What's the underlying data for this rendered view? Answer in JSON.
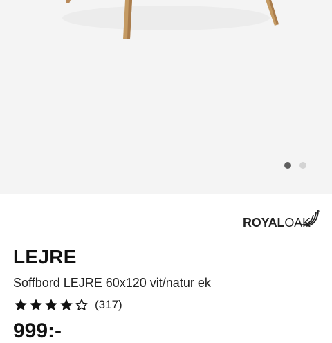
{
  "gallery": {
    "slide_count": 2,
    "active_slide": 1
  },
  "brand": {
    "logo_royal": "ROYAL",
    "logo_oak": "OAK"
  },
  "product": {
    "name": "LEJRE",
    "description": "Soffbord LEJRE 60x120 vit/natur ek",
    "rating": {
      "stars_filled": 4,
      "stars_total": 5,
      "review_count": "(317)"
    },
    "price": "999:-"
  },
  "colors": {
    "gallery_background": "#f4f4f4",
    "leg_wood": "#c49a63",
    "dot_active": "#5e5e5e",
    "dot_inactive": "#d3d3d3",
    "star": "#111111"
  },
  "icons": {
    "star_filled": "star-filled-icon",
    "star_empty": "star-empty-icon",
    "logo_swoosh": "oak-swoosh-icon"
  }
}
